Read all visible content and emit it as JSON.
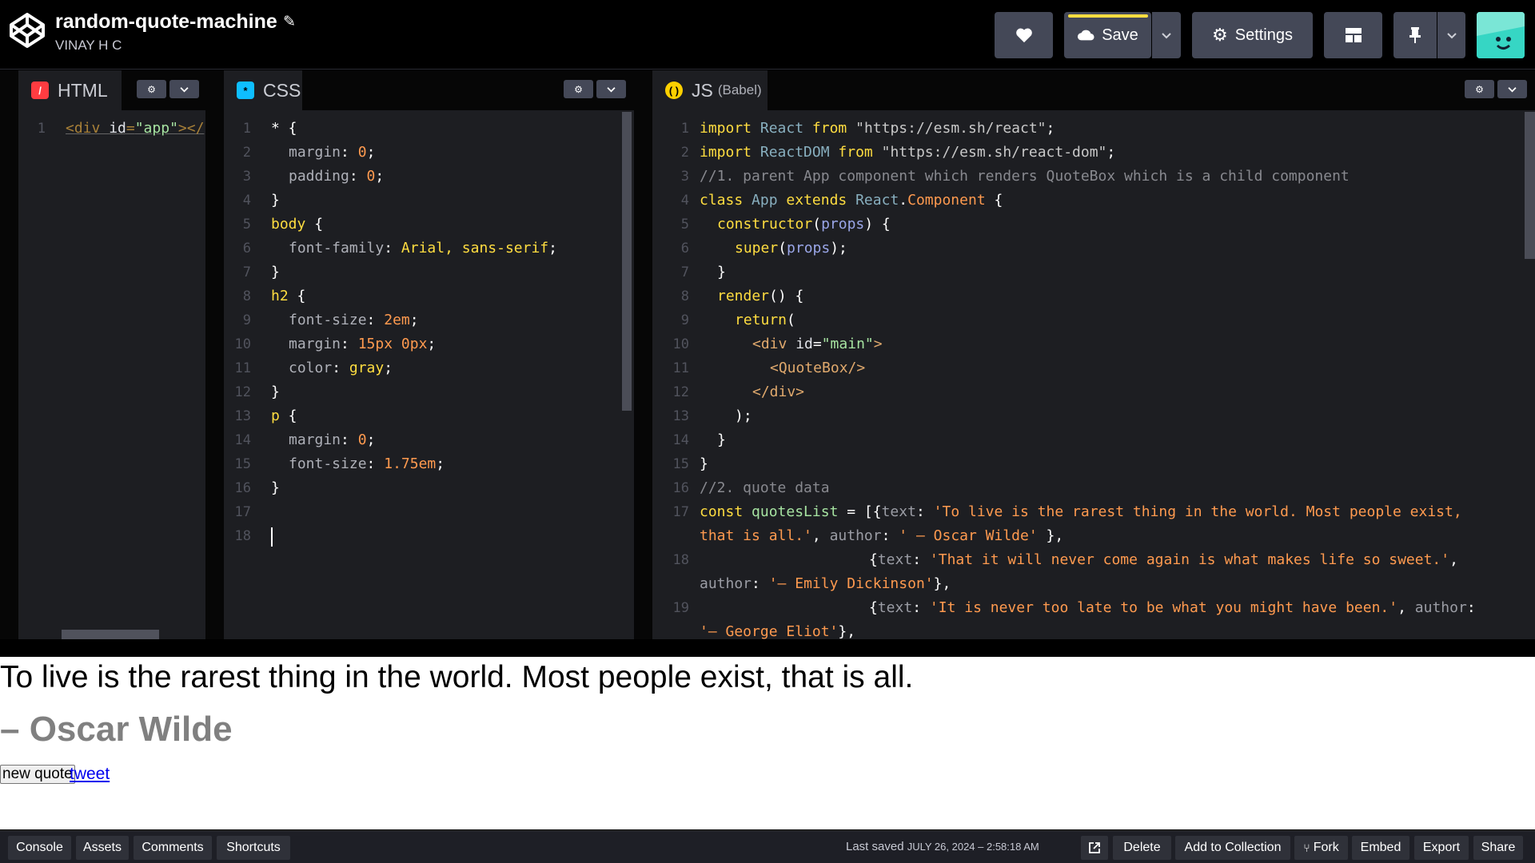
{
  "header": {
    "title": "random-quote-machine",
    "user": "VINAY H C",
    "save_label": "Save",
    "settings_label": "Settings"
  },
  "editors": {
    "html": {
      "tab_label": "HTML",
      "lines": [
        [
          "1",
          "<div id=\"app\"></"
        ]
      ]
    },
    "css": {
      "tab_label": "CSS",
      "lines": [
        "1",
        "2",
        "3",
        "4",
        "5",
        "6",
        "7",
        "8",
        "9",
        "10",
        "11",
        "12",
        "13",
        "14",
        "15",
        "16",
        "17",
        "18"
      ]
    },
    "js": {
      "tab_label": "JS",
      "tab_sub": "(Babel)",
      "lines": [
        "1",
        "2",
        "3",
        "4",
        "5",
        "6",
        "7",
        "8",
        "9",
        "10",
        "11",
        "12",
        "13",
        "14",
        "15",
        "16",
        "17",
        "",
        "18",
        "",
        "19",
        ""
      ]
    }
  },
  "preview": {
    "quote": "To live is the rarest thing in the world. Most people exist, that is all.",
    "author": "– Oscar Wilde",
    "new_quote_label": "new quote",
    "tweet_label": "tweet"
  },
  "footer": {
    "console": "Console",
    "assets": "Assets",
    "comments": "Comments",
    "shortcuts": "Shortcuts",
    "last_saved_prefix": "Last saved",
    "last_saved_value": "JULY 26, 2024 – 2:58:18 AM",
    "delete": "Delete",
    "add_to_collection": "Add to Collection",
    "fork": "Fork",
    "embed": "Embed",
    "export": "Export",
    "share": "Share"
  },
  "colors": {
    "save_bar": "#ffdd40",
    "button_bg": "#444857",
    "editor_bg": "#1d1e22",
    "html_badge": "#ff3c41",
    "css_badge": "#0ebeff",
    "js_badge": "#fcd000"
  }
}
